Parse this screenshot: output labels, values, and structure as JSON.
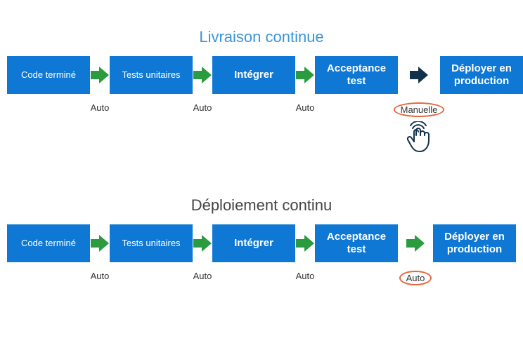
{
  "diagram1": {
    "title": "Livraison continue",
    "boxes": [
      {
        "label": "Code terminé",
        "size": "sm"
      },
      {
        "label": "Tests unitaires",
        "size": "sm"
      },
      {
        "label": "Intégrer",
        "size": "md"
      },
      {
        "label": "Acceptance test",
        "size": "md"
      },
      {
        "label": "Déployer en production",
        "size": "md"
      }
    ],
    "arrows": [
      {
        "label": "Auto",
        "color": "green",
        "highlight": false
      },
      {
        "label": "Auto",
        "color": "green",
        "highlight": false
      },
      {
        "label": "Auto",
        "color": "green",
        "highlight": false
      },
      {
        "label": "Manuelle",
        "color": "dark",
        "highlight": true,
        "hand": true
      }
    ]
  },
  "diagram2": {
    "title": "Déploiement continu",
    "boxes": [
      {
        "label": "Code terminé",
        "size": "sm"
      },
      {
        "label": "Tests unitaires",
        "size": "sm"
      },
      {
        "label": "Intégrer",
        "size": "md"
      },
      {
        "label": "Acceptance test",
        "size": "md"
      },
      {
        "label": "Déployer en production",
        "size": "md"
      }
    ],
    "arrows": [
      {
        "label": "Auto",
        "color": "green",
        "highlight": false
      },
      {
        "label": "Auto",
        "color": "green",
        "highlight": false
      },
      {
        "label": "Auto",
        "color": "green",
        "highlight": false
      },
      {
        "label": "Auto",
        "color": "green",
        "highlight": true
      }
    ]
  }
}
